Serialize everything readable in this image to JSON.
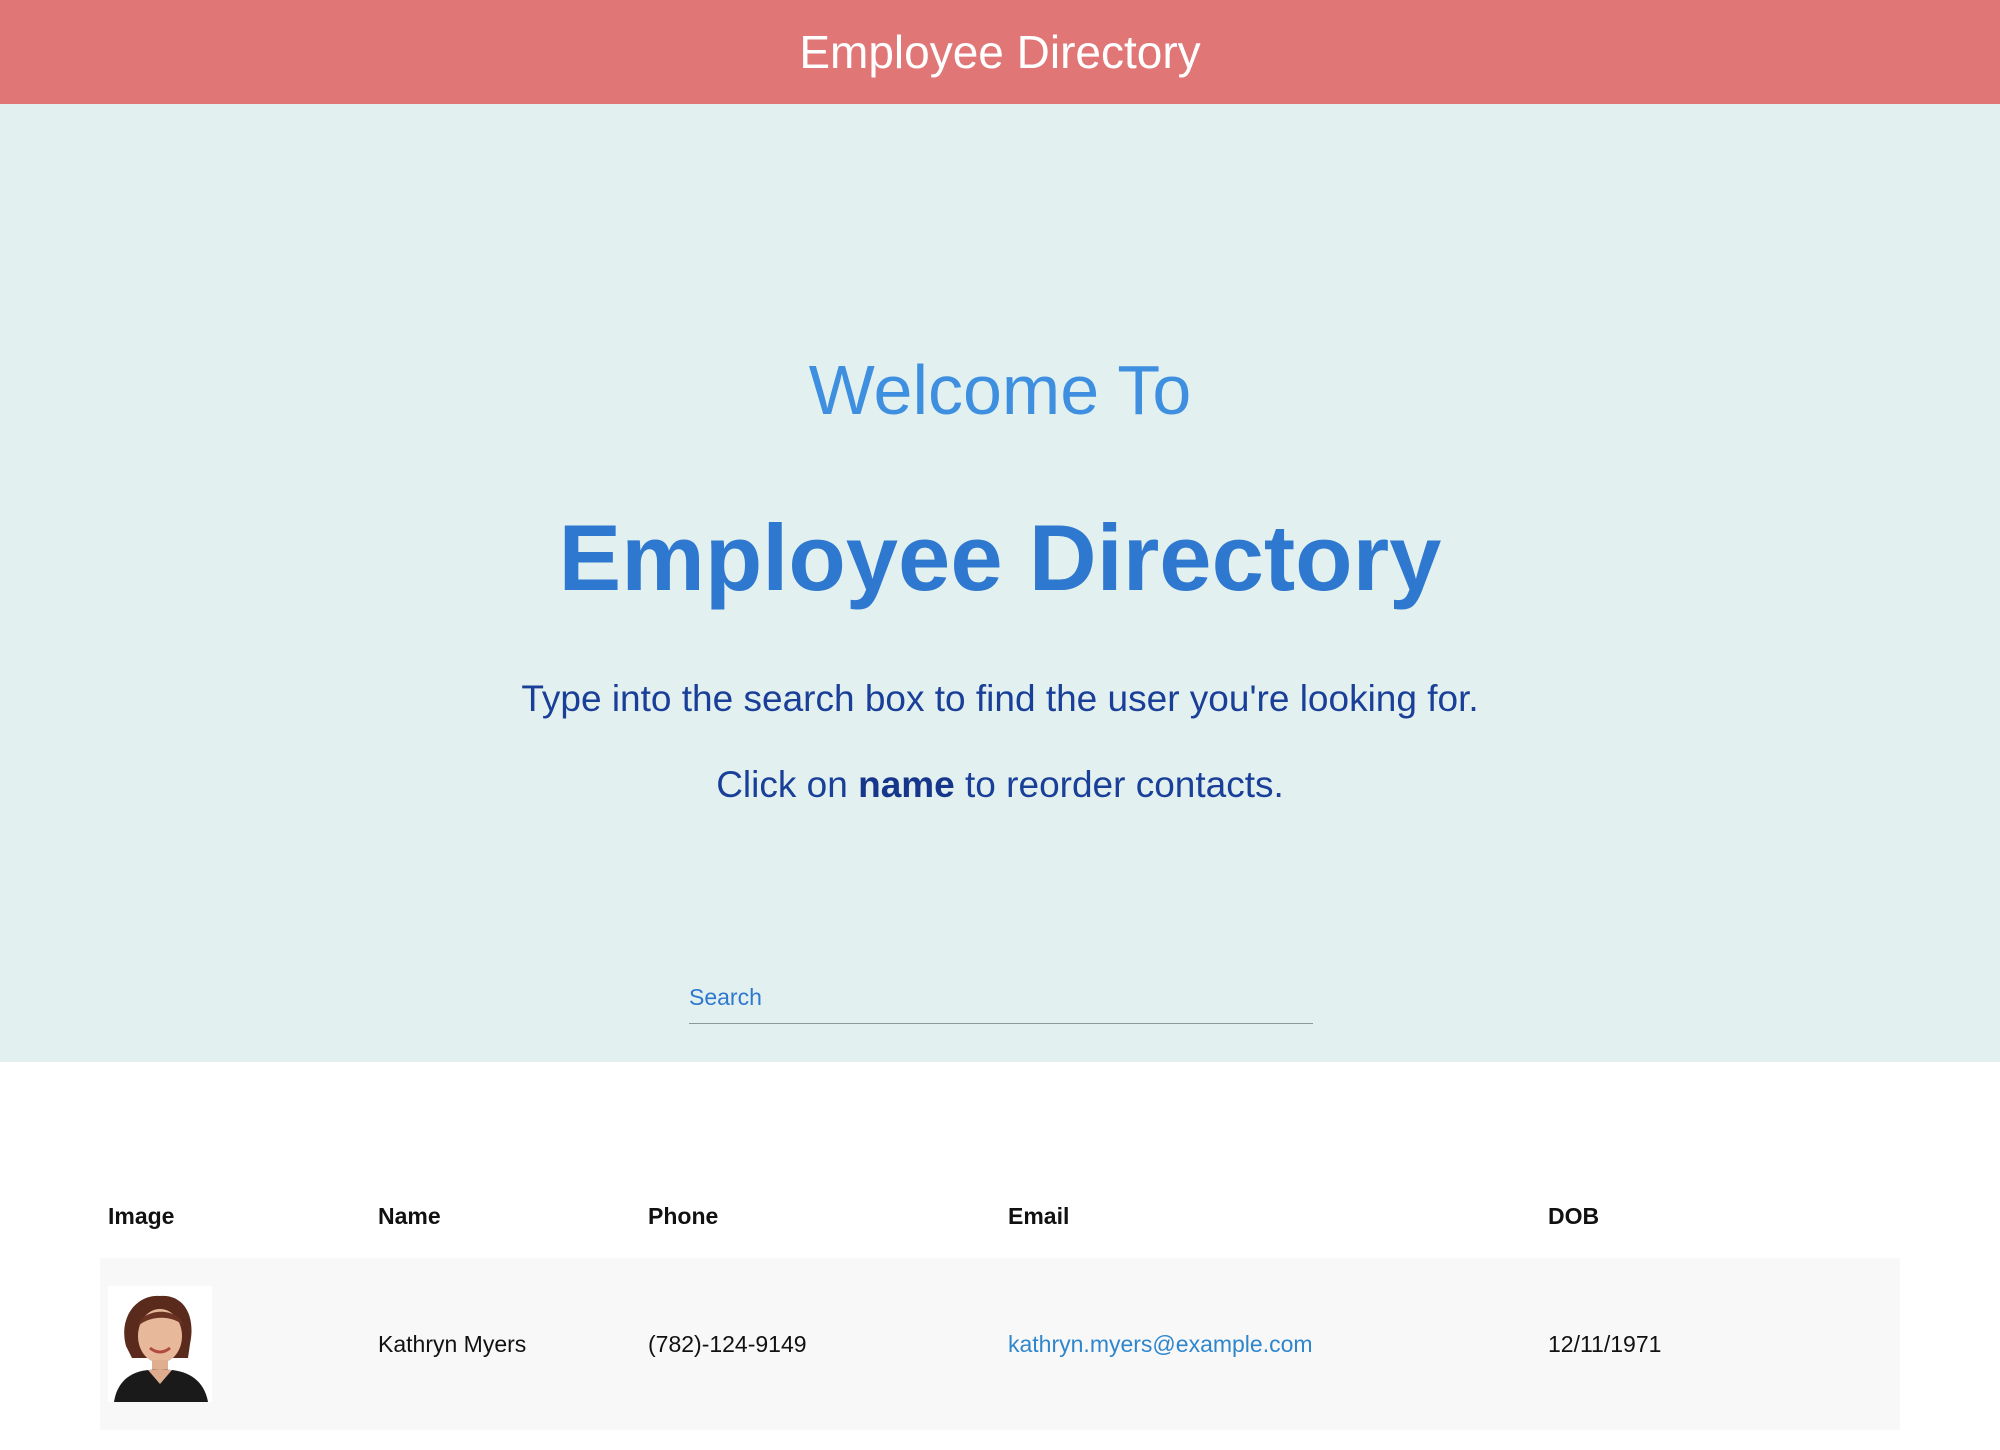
{
  "navbar": {
    "title": "Employee Directory"
  },
  "hero": {
    "welcome": "Welcome To",
    "title": "Employee Directory",
    "instruction_1": "Type into the search box to find the user you're looking for.",
    "instruction_2_pre": "Click on ",
    "instruction_2_bold": "name",
    "instruction_2_post": " to reorder contacts."
  },
  "search": {
    "placeholder": "Search",
    "value": ""
  },
  "table": {
    "headers": [
      "Image",
      "Name",
      "Phone",
      "Email",
      "DOB"
    ],
    "rows": [
      {
        "image": "employee-photo",
        "name": "Kathryn Myers",
        "phone": "(782)-124-9149",
        "email": "kathryn.myers@example.com",
        "dob": "12/11/1971"
      }
    ]
  },
  "colors": {
    "navbar": "#e07676",
    "hero_bg": "#e2f0ef",
    "heading": "#2f78d0",
    "link": "#2f86cc"
  }
}
